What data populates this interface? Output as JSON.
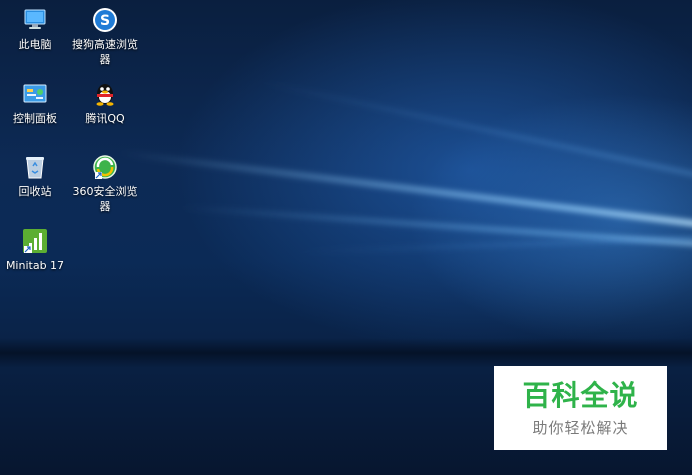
{
  "desktop": {
    "icons": [
      {
        "label": "此电脑",
        "icon": "computer-icon"
      },
      {
        "label": "搜狗高速浏览器",
        "icon": "sogou-browser-icon"
      },
      {
        "label": "控制面板",
        "icon": "control-panel-icon"
      },
      {
        "label": "腾讯QQ",
        "icon": "qq-penguin-icon"
      },
      {
        "label": "回收站",
        "icon": "recycle-bin-icon"
      },
      {
        "label": "360安全浏览器",
        "icon": "360-browser-icon"
      },
      {
        "label": "Minitab 17",
        "icon": "minitab-icon"
      }
    ]
  },
  "watermark": {
    "title": "百科全说",
    "subtitle": "助你轻松解决"
  },
  "colors": {
    "watermark_green": "#2fb34a",
    "desktop_blue": "#0d2a55"
  }
}
